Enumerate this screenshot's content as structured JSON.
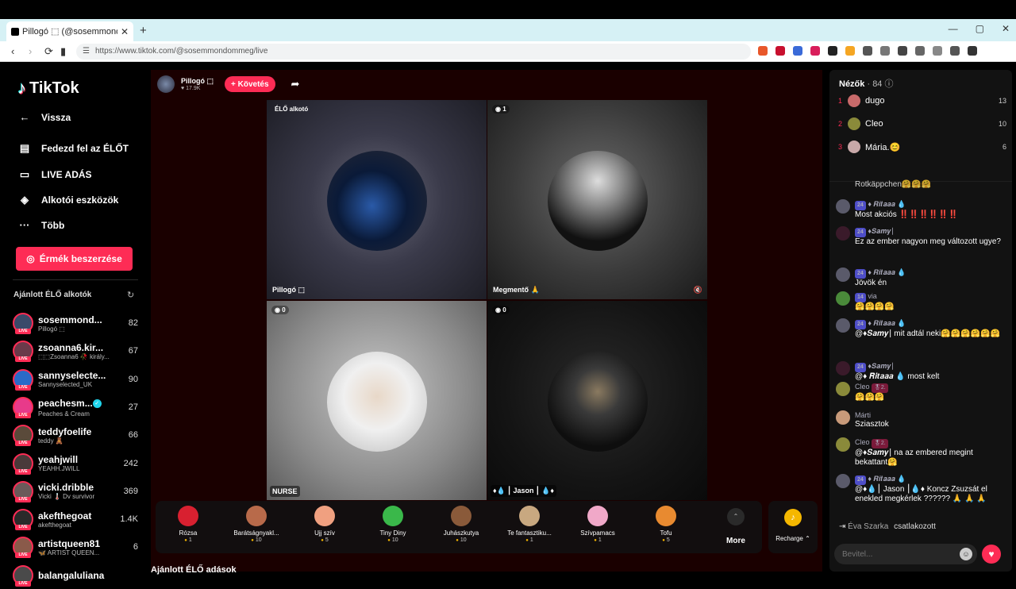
{
  "browser": {
    "tab_title": "Pillogó ⬚ (@sosemmondommeg)",
    "tab_close": "✕",
    "new_tab": "+",
    "url": "https://www.tiktok.com/@sosemmondommeg/live",
    "window_controls": [
      "—",
      "▢",
      "✕"
    ]
  },
  "nav": {
    "logo_text": "TikTok",
    "back": "Vissza",
    "explore": "Fedezd fel az ÉLŐT",
    "live": "LIVE ADÁS",
    "tools": "Alkotói eszközök",
    "more": "Több",
    "coins_button": "Érmék beszerzése",
    "suggested_title": "Ajánlott ÉLŐ alkotók",
    "creators": [
      {
        "name": "sosemmond...",
        "sub": "Pillogó ⬚",
        "count": "82",
        "color": "#3a4a6a"
      },
      {
        "name": "zsoanna6.kir...",
        "sub": "⬚⬚Zsoanna6 🥀 király...",
        "count": "67",
        "color": "#6a3a4a"
      },
      {
        "name": "sannyselecte...",
        "sub": "Sannyselected_UK",
        "count": "90",
        "color": "#2a6ac8"
      },
      {
        "name": "peachesm...",
        "sub": "Peaches & Cream",
        "count": "27",
        "color": "#e83a8a",
        "verified": "✓"
      },
      {
        "name": "teddyfoelife",
        "sub": "teddy 🧸",
        "count": "66",
        "color": "#5a4a3a"
      },
      {
        "name": "yeahjwill",
        "sub": "YEAHH.JWILL",
        "count": "242",
        "color": "#4a3a3a"
      },
      {
        "name": "vicki.dribble",
        "sub": "Vicki 🌡️ Dv survivor",
        "count": "369",
        "color": "#6a5a5a"
      },
      {
        "name": "akefthegoat",
        "sub": "akefthegoat",
        "count": "1.4K",
        "color": "#2a2a2a"
      },
      {
        "name": "artistqueen81",
        "sub": "🦋 ARTIST QUEEN...",
        "count": "6",
        "color": "#8a5a4a"
      },
      {
        "name": "balangaluliana",
        "sub": "",
        "count": "",
        "color": "#4a4a4a"
      }
    ]
  },
  "host": {
    "name": "Pillogó ⬚",
    "likes": "♥ 17.9K",
    "follow": "+ Követés"
  },
  "tiles": [
    {
      "badge": "ÉLŐ alkotó",
      "label": "Pillogó ⬚"
    },
    {
      "badge": "◉ 1",
      "label": "Megmentő 🙏"
    },
    {
      "badge": "◉ 0",
      "label": "NURSE"
    },
    {
      "badge": "◉ 0",
      "label": "♦💧 ⎮ Jason ⎮ 💧♦"
    }
  ],
  "gifts": [
    {
      "name": "Rózsa",
      "price": "1",
      "color": "#d82030"
    },
    {
      "name": "Barátságnyakl...",
      "price": "10",
      "color": "#b86a4a"
    },
    {
      "name": "Ujj szív",
      "price": "5",
      "color": "#f0a080"
    },
    {
      "name": "Tiny Diny",
      "price": "10",
      "color": "#3ab84a"
    },
    {
      "name": "Juhászkutya",
      "price": "10",
      "color": "#8a5a3a"
    },
    {
      "name": "Te fantasztiku...",
      "price": "1",
      "color": "#c8a880"
    },
    {
      "name": "Szívpamacs",
      "price": "1",
      "color": "#f0a8c8"
    },
    {
      "name": "Tofu",
      "price": "5",
      "color": "#e88a30"
    }
  ],
  "more_label": "More",
  "recharge_label": "Recharge ⌃",
  "bottom_heading": "Ajánlott ÉLŐ adások",
  "viewers": {
    "title": "Nézők",
    "count": "· 84",
    "list": [
      {
        "rank": "1",
        "name": "dugo",
        "score": "13",
        "color": "#c86a6a"
      },
      {
        "rank": "2",
        "name": "Cleo",
        "score": "10",
        "color": "#8a8a3a"
      },
      {
        "rank": "3",
        "name": "Mária.😊",
        "score": "6",
        "color": "#c8a8a8"
      }
    ]
  },
  "chat": [
    {
      "user": "",
      "level": "",
      "text": "Rotkäppchen🤗🤗🤗",
      "color": "#333"
    },
    {
      "user": "♦ 𝑹𝒊𝒕𝒂𝒂𝒂 💧",
      "level": "24",
      "text": "Most akciós ‼️‼️‼️‼️‼️‼️",
      "color": "#5a5a6a"
    },
    {
      "user": "♦𝑺𝒂𝒎𝒚⎮",
      "level": "24",
      "text": "Ez az ember nagyon meg változott ugye?",
      "color": "#3a1a2a"
    },
    {
      "user": "♦ 𝑹𝒊𝒕𝒂𝒂𝒂 💧",
      "level": "24",
      "text": "Jövök én",
      "color": "#5a5a6a"
    },
    {
      "user": "via",
      "level": "14",
      "text": "🤗🤗🤗🤗",
      "color": "#4a8a3a"
    },
    {
      "user": "♦ 𝑹𝒊𝒕𝒂𝒂𝒂 💧",
      "level": "24",
      "text": "@♦𝑺𝒂𝒎𝒚⎮ mit adtál neki🤗🤗🤗🤗🤗🤗",
      "color": "#5a5a6a"
    },
    {
      "user": "♦𝑺𝒂𝒎𝒚⎮",
      "level": "24",
      "text": "@♦ 𝑹𝒊𝒕𝒂𝒂𝒂 💧 most kelt",
      "color": "#3a1a2a"
    },
    {
      "user": "Cleo",
      "level": "",
      "text": "🤗🤗🤗",
      "color": "#8a8a3a",
      "badge": "🎖2."
    },
    {
      "user": "Márti",
      "level": "",
      "text": "Sziasztok",
      "color": "#c89a7a"
    },
    {
      "user": "Cleo",
      "level": "",
      "text": "@♦𝑺𝒂𝒎𝒚⎮ na az embered megint bekattant🤗",
      "color": "#8a8a3a",
      "badge": "🎖2."
    },
    {
      "user": "♦ 𝑹𝒊𝒕𝒂𝒂𝒂 💧",
      "level": "24",
      "text": "@♦💧⎮ Jason ⎮💧♦ Koncz Zsuzsát el enekled megkérlek ?????? 🙏 🙏 🙏",
      "color": "#5a5a6a"
    }
  ],
  "joined": {
    "name": "Éva Szarka",
    "text": "csatlakozott"
  },
  "input_placeholder": "Bevitel..."
}
